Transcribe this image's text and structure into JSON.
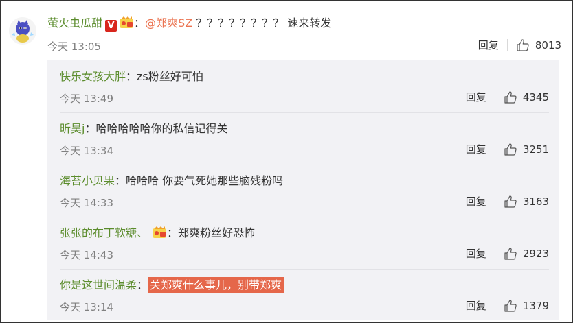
{
  "main_comment": {
    "username": "萤火虫瓜甜",
    "vip_badge": "V",
    "fan_badge_icon": "fan-club-badge-icon",
    "colon": "：",
    "mention": "@郑爽SZ",
    "text": " ？？？？？？？？ 速来转发",
    "time": "今天 13:05",
    "reply_label": "回复",
    "likes": "8013"
  },
  "replies": [
    {
      "username": "快乐女孩大胖",
      "colon": "：",
      "text": "zs粉丝好可怕",
      "highlight": "",
      "time": "今天 13:49",
      "reply_label": "回复",
      "likes": "4345",
      "badge": false
    },
    {
      "username": "昕昊j",
      "colon": "：",
      "text": "哈哈哈哈哈你的私信记得关",
      "highlight": "",
      "time": "今天 13:34",
      "reply_label": "回复",
      "likes": "3251",
      "badge": false
    },
    {
      "username": "海苔小贝果",
      "colon": "：",
      "text": "哈哈哈 你要气死她那些脑残粉吗",
      "highlight": "",
      "time": "今天 14:33",
      "reply_label": "回复",
      "likes": "3163",
      "badge": false
    },
    {
      "username": "张张的布丁软糖、",
      "colon": "：",
      "text": "郑爽粉丝好恐怖",
      "highlight": "",
      "time": "今天 14:43",
      "reply_label": "回复",
      "likes": "2923",
      "badge": true
    },
    {
      "username": "你是这世间温柔",
      "colon": "：",
      "text": "",
      "highlight": "关郑爽什么事儿，别带郑爽",
      "time": "今天 13:14",
      "reply_label": "回复",
      "likes": "1379",
      "badge": false
    }
  ],
  "colors": {
    "username": "#5b8c2c",
    "mention": "#eb7350",
    "highlight_bg": "#e5674a"
  }
}
